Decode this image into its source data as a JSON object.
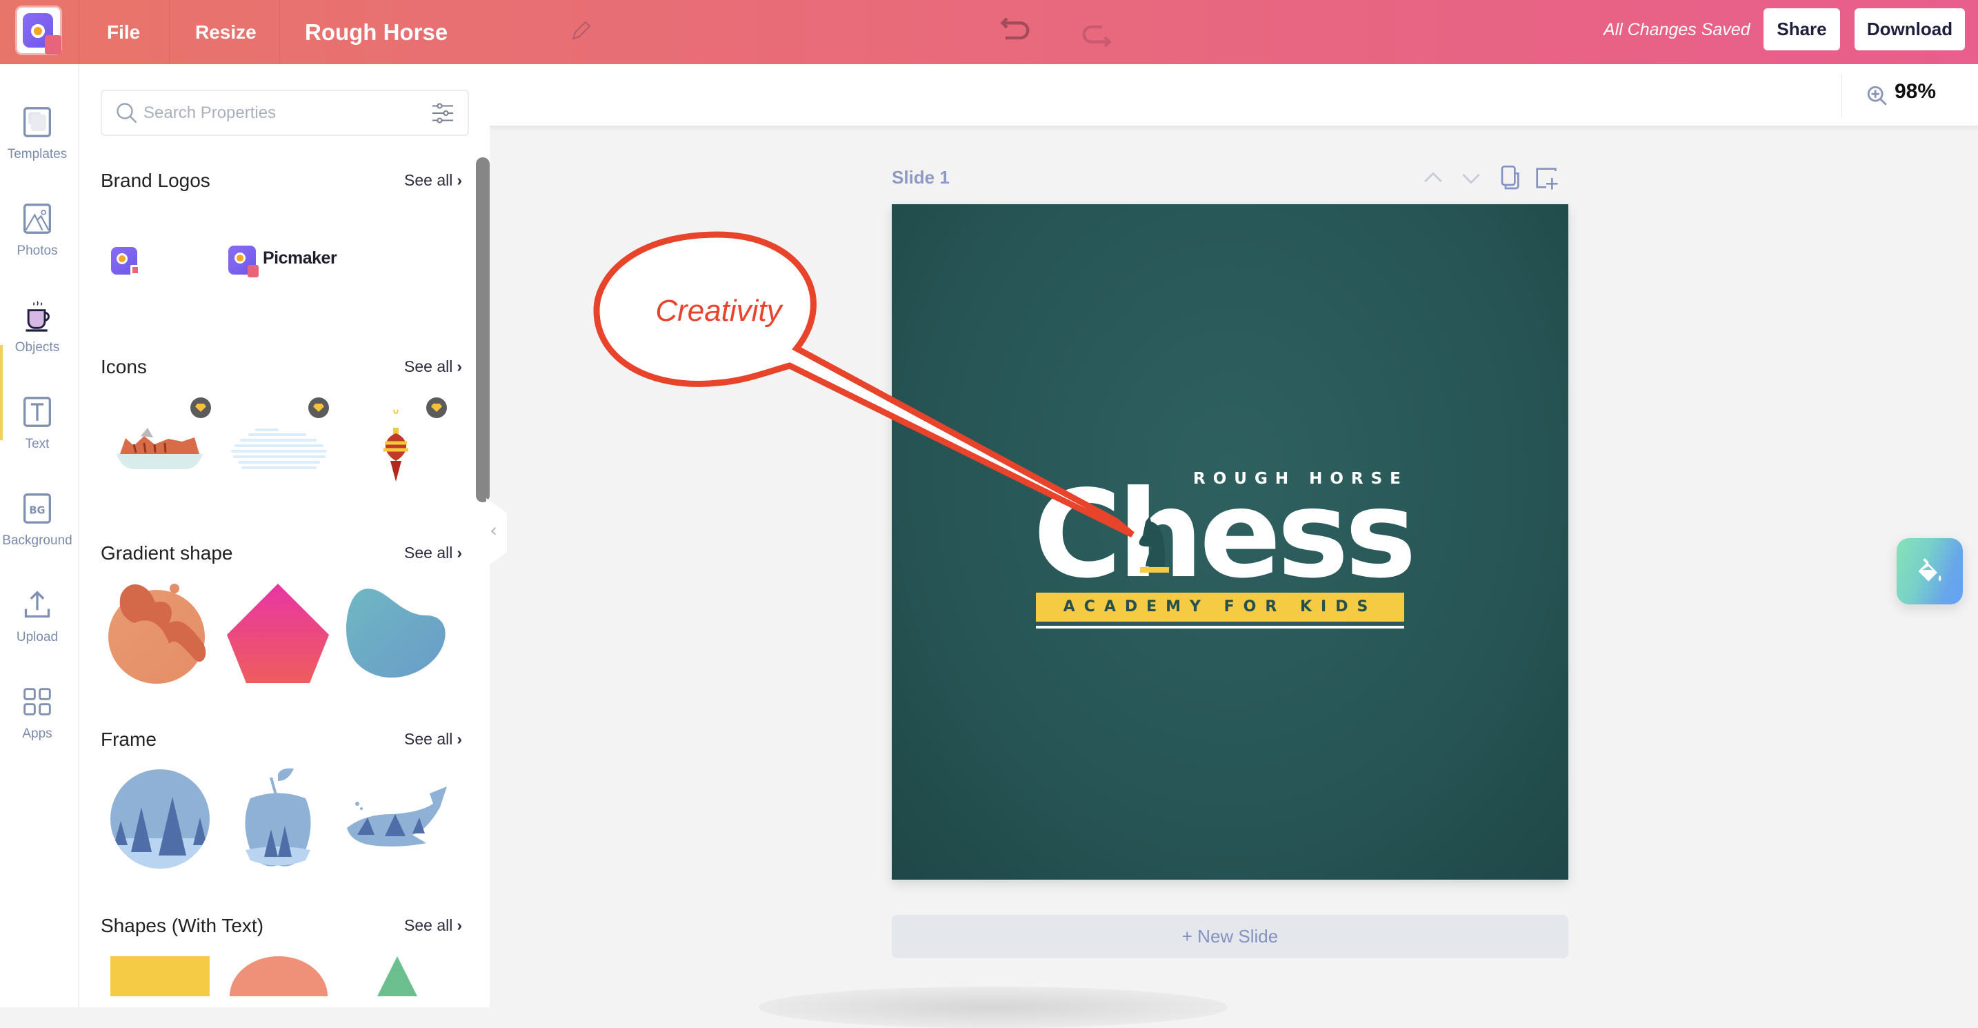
{
  "topbar": {
    "menu_file": "File",
    "menu_resize": "Resize",
    "doc_title": "Rough Horse",
    "save_status": "All Changes Saved",
    "share_label": "Share",
    "download_label": "Download",
    "accent_start": "#e8756a",
    "accent_end": "#e85e8c"
  },
  "toolbar": {
    "zoom_level": "98%"
  },
  "rail": {
    "items": [
      {
        "label": "Templates",
        "icon": "templates-icon"
      },
      {
        "label": "Photos",
        "icon": "photos-icon"
      },
      {
        "label": "Objects",
        "icon": "objects-icon",
        "active": true
      },
      {
        "label": "Text",
        "icon": "text-icon"
      },
      {
        "label": "Background",
        "icon": "background-icon",
        "icon_text": "BG"
      },
      {
        "label": "Upload",
        "icon": "upload-icon"
      },
      {
        "label": "Apps",
        "icon": "apps-icon"
      }
    ]
  },
  "panel": {
    "search_placeholder": "Search Properties",
    "see_all": "See all",
    "sections": [
      {
        "title": "Brand Logos",
        "items": [
          "logo-icon-only",
          "logo-with-wordmark"
        ],
        "wordmark": "Picmaker"
      },
      {
        "title": "Icons",
        "items": [
          "grilled-food-plate",
          "cloud-lines",
          "ornament"
        ],
        "premium": true
      },
      {
        "title": "Gradient shape",
        "items": [
          "orange-blob",
          "pink-pentagon",
          "blue-blob"
        ]
      },
      {
        "title": "Frame",
        "items": [
          "circle-forest-frame",
          "apple-forest-frame",
          "whale-forest-frame"
        ]
      },
      {
        "title": "Shapes (With Text)",
        "items": [
          "yellow-rectangle",
          "salmon-semicircle",
          "green-triangle"
        ]
      }
    ]
  },
  "canvas": {
    "slide_label": "Slide 1",
    "new_slide_label": "+ New Slide",
    "slide": {
      "top_text": "ROUGH HORSE",
      "main_text": "Chess",
      "banner_text": "ACADEMY FOR KIDS",
      "bg_color": "#275555",
      "banner_color": "#f4cb43"
    },
    "callout": {
      "text": "Creativity",
      "stroke_color": "#e8432b"
    }
  }
}
